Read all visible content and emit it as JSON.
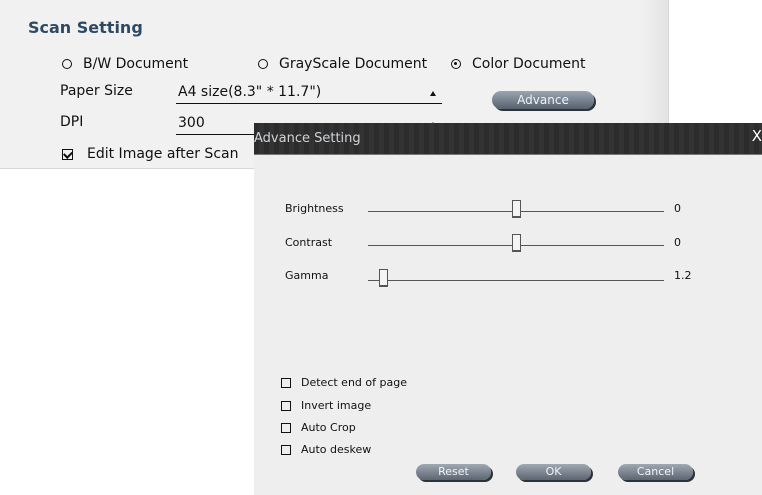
{
  "scan_setting": {
    "title": "Scan Setting",
    "doc_types": [
      {
        "label": "B/W Document",
        "selected": false
      },
      {
        "label": "GrayScale Document",
        "selected": false
      },
      {
        "label": "Color Document",
        "selected": true
      }
    ],
    "paper_size": {
      "label": "Paper Size",
      "value": "A4 size(8.3\" * 11.7\")"
    },
    "dpi": {
      "label": "DPI",
      "value": "300"
    },
    "advance_button": "Advance",
    "edit_image": {
      "label": "Edit Image after Scan",
      "checked": true
    }
  },
  "advance_setting": {
    "title": "Advance Setting",
    "close_glyph": "X",
    "sliders": [
      {
        "label": "Brightness",
        "value": "0",
        "fraction": 0.5
      },
      {
        "label": "Contrast",
        "value": "0",
        "fraction": 0.5
      },
      {
        "label": "Gamma",
        "value": "1.2",
        "fraction": 0.05
      }
    ],
    "options": [
      {
        "label": "Detect end of page",
        "checked": false
      },
      {
        "label": "Invert image",
        "checked": false
      },
      {
        "label": "Auto Crop",
        "checked": false
      },
      {
        "label": "Auto deskew",
        "checked": false
      }
    ],
    "buttons": {
      "reset": "Reset",
      "ok": "OK",
      "cancel": "Cancel"
    }
  }
}
